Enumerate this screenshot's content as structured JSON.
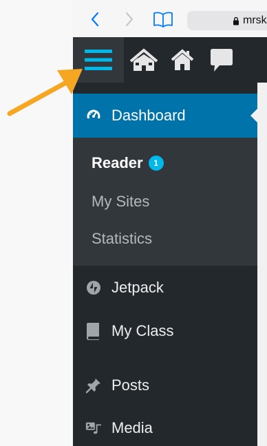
{
  "browser": {
    "url_text": "mrsk",
    "icons": {
      "back": "chevron-left-icon",
      "forward": "chevron-right-icon",
      "bookmarks": "book-icon",
      "lock": "lock-icon"
    },
    "accent_color": "#007aff"
  },
  "admin_bar": {
    "icons": [
      "menu-toggle-icon",
      "my-sites-icon",
      "home-icon",
      "comments-icon"
    ],
    "toggle_color": "#00b9eb"
  },
  "sidebar": {
    "dashboard_label": "Dashboard",
    "submenu": {
      "reader_label": "Reader",
      "reader_badge": "1",
      "my_sites_label": "My Sites",
      "statistics_label": "Statistics"
    },
    "items": [
      {
        "label": "Jetpack",
        "icon": "jetpack-icon"
      },
      {
        "label": "My Class",
        "icon": "book-icon"
      },
      {
        "label": "Posts",
        "icon": "pin-icon"
      },
      {
        "label": "Media",
        "icon": "media-icon"
      }
    ],
    "colors": {
      "background": "#23282d",
      "submenu_background": "#32373c",
      "active": "#0073aa",
      "badge": "#00b9eb"
    }
  },
  "annotation": {
    "arrow_color": "#f5a623",
    "target": "menu-toggle"
  }
}
